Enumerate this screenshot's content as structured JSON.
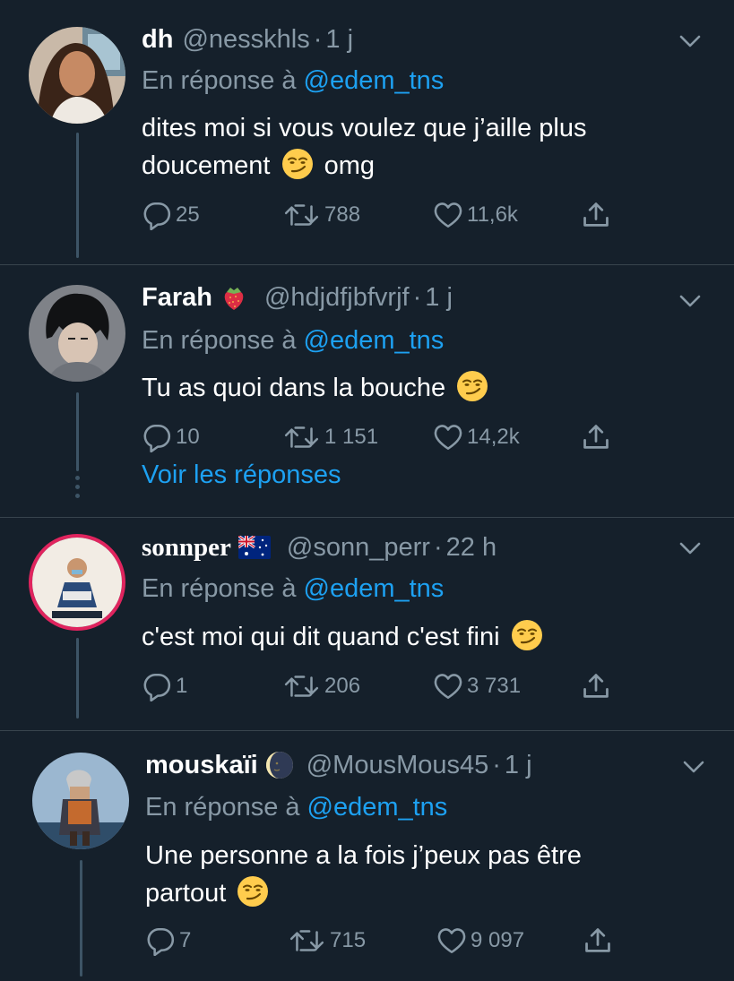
{
  "colors": {
    "background": "#15202b",
    "divider": "#38444d",
    "secondary_text": "#8899a6",
    "link": "#1da1f2"
  },
  "tweets": [
    {
      "name": "dh",
      "handle": "@nesskhls",
      "separator": "·",
      "time": "1 j",
      "reply_prefix": "En réponse à",
      "reply_to": "@edem_tns",
      "text_parts": [
        "dites moi si vous voulez que j’aille plus",
        "doucement",
        "omg"
      ],
      "emoji": "smirking-face",
      "replies": "25",
      "retweets": "788",
      "likes": "11,6k"
    },
    {
      "name": "Farah",
      "name_emoji": "strawberry",
      "handle": "@hdjdfjbfvrjf",
      "separator": "·",
      "time": "1 j",
      "reply_prefix": "En réponse à",
      "reply_to": "@edem_tns",
      "text_parts": [
        "Tu as quoi dans la bouche"
      ],
      "emoji": "smirking-face",
      "replies": "10",
      "retweets": "1 151",
      "likes": "14,2k",
      "see_replies": "Voir les réponses"
    },
    {
      "name": "sonnper",
      "name_emoji": "flag-australia",
      "handle": "@sonn_perr",
      "separator": "·",
      "time": "22 h",
      "reply_prefix": "En réponse à",
      "reply_to": "@edem_tns",
      "text_parts": [
        "c'est moi qui dit quand c'est fini"
      ],
      "emoji": "smirking-face",
      "replies": "1",
      "retweets": "206",
      "likes": "3 731"
    },
    {
      "name": "mouskaïi",
      "name_emoji": "new-moon-face",
      "handle": "@MousMous45",
      "separator": "·",
      "time": "1 j",
      "reply_prefix": "En réponse à",
      "reply_to": "@edem_tns",
      "text_parts": [
        "Une personne a la fois j’peux pas être",
        "partout"
      ],
      "emoji": "smirking-face",
      "replies": "7",
      "retweets": "715",
      "likes": "9 097"
    }
  ]
}
